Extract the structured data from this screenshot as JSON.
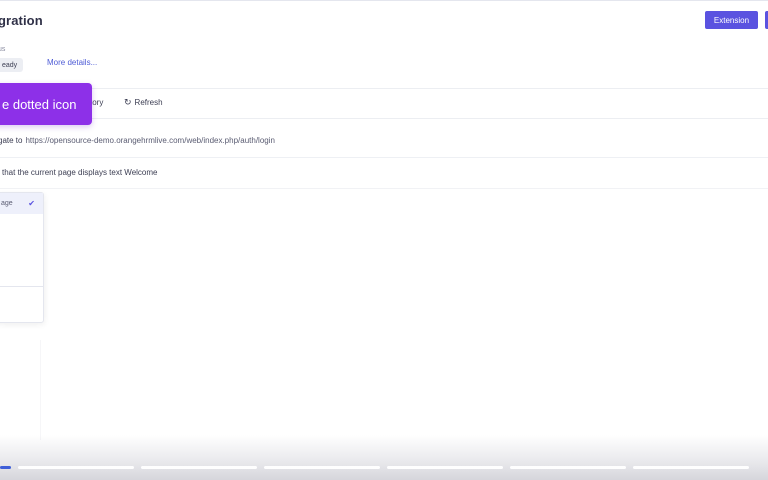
{
  "header": {
    "title": "gration",
    "extension_button": "Extension"
  },
  "status": {
    "label": "us",
    "badge": "eady",
    "more_details_link": "More details..."
  },
  "tooltip": {
    "text": "e dotted icon"
  },
  "toolbar": {
    "history_tab": "tory",
    "refresh_label": "Refresh",
    "refresh_icon": "refresh-icon"
  },
  "steps": [
    {
      "prefix": "gate to",
      "url": "https://opensource-demo.orangehrmlive.com/web/index.php/auth/login"
    },
    {
      "text": "that the current page displays text Welcome"
    }
  ],
  "dropdown": {
    "selected_item": "age",
    "selected_icon": "check-icon"
  },
  "player": {
    "segments": 7,
    "progress_fraction": 0.015
  },
  "colors": {
    "accent": "#5a52e0",
    "tooltip": "#8d30e8",
    "link": "#4d5bd6",
    "progress": "#3f5fd8"
  }
}
